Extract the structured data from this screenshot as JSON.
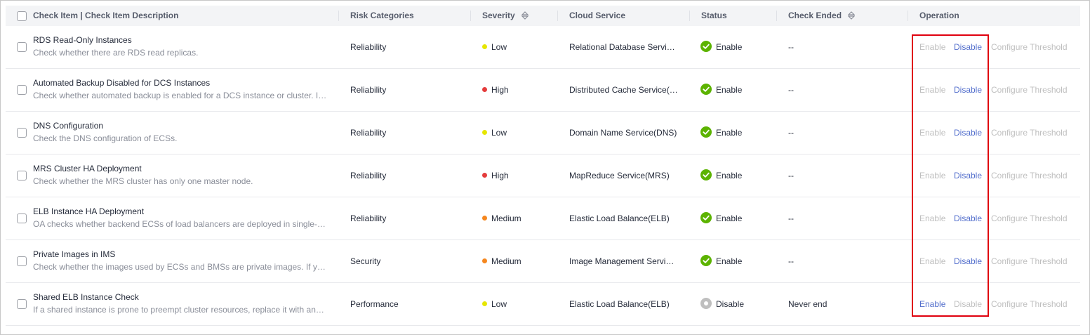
{
  "header": {
    "col_check_item": "Check Item | Check Item Description",
    "col_risk": "Risk Categories",
    "col_severity": "Severity",
    "col_service": "Cloud Service",
    "col_status": "Status",
    "col_check_ended": "Check Ended",
    "col_operation": "Operation"
  },
  "colors": {
    "severity_low": "#e6e600",
    "severity_high": "#e43c3c",
    "severity_medium": "#f5871f",
    "status_enable": "#5cb300",
    "status_disable": "#bfbfbf",
    "link": "#526ecc",
    "link_disabled": "#bfbfbf",
    "highlight": "#e0000e"
  },
  "rows": [
    {
      "title": "RDS Read-Only Instances",
      "desc": "Check whether there are RDS read replicas.",
      "risk": "Reliability",
      "severity": "Low",
      "service": "Relational Database Servi…",
      "status": "Enable",
      "check_ended": "--",
      "ops": {
        "enable": "Enable",
        "disable": "Disable",
        "threshold": "Configure Threshold"
      }
    },
    {
      "title": "Automated Backup Disabled for DCS Instances",
      "desc": "Check whether automated backup is enabled for a DCS instance or cluster. I…",
      "risk": "Reliability",
      "severity": "High",
      "service": "Distributed Cache Service(…",
      "status": "Enable",
      "check_ended": "--",
      "ops": {
        "enable": "Enable",
        "disable": "Disable",
        "threshold": "Configure Threshold"
      }
    },
    {
      "title": "DNS Configuration",
      "desc": "Check the DNS configuration of ECSs.",
      "risk": "Reliability",
      "severity": "Low",
      "service": "Domain Name Service(DNS)",
      "status": "Enable",
      "check_ended": "--",
      "ops": {
        "enable": "Enable",
        "disable": "Disable",
        "threshold": "Configure Threshold"
      }
    },
    {
      "title": "MRS Cluster HA Deployment",
      "desc": "Check whether the MRS cluster has only one master node.",
      "risk": "Reliability",
      "severity": "High",
      "service": "MapReduce Service(MRS)",
      "status": "Enable",
      "check_ended": "--",
      "ops": {
        "enable": "Enable",
        "disable": "Disable",
        "threshold": "Configure Threshold"
      }
    },
    {
      "title": "ELB Instance HA Deployment",
      "desc": "OA checks whether backend ECSs of load balancers are deployed in single-…",
      "risk": "Reliability",
      "severity": "Medium",
      "service": "Elastic Load Balance(ELB)",
      "status": "Enable",
      "check_ended": "--",
      "ops": {
        "enable": "Enable",
        "disable": "Disable",
        "threshold": "Configure Threshold"
      }
    },
    {
      "title": "Private Images in IMS",
      "desc": "Check whether the images used by ECSs and BMSs are private images. If y…",
      "risk": "Security",
      "severity": "Medium",
      "service": "Image Management Servi…",
      "status": "Enable",
      "check_ended": "--",
      "ops": {
        "enable": "Enable",
        "disable": "Disable",
        "threshold": "Configure Threshold"
      }
    },
    {
      "title": "Shared ELB Instance Check",
      "desc": "If a shared instance is prone to preempt cluster resources, replace it with an…",
      "risk": "Performance",
      "severity": "Low",
      "service": "Elastic Load Balance(ELB)",
      "status": "Disable",
      "check_ended": "Never end",
      "ops": {
        "enable": "Enable",
        "disable": "Disable",
        "threshold": "Configure Threshold"
      }
    }
  ]
}
